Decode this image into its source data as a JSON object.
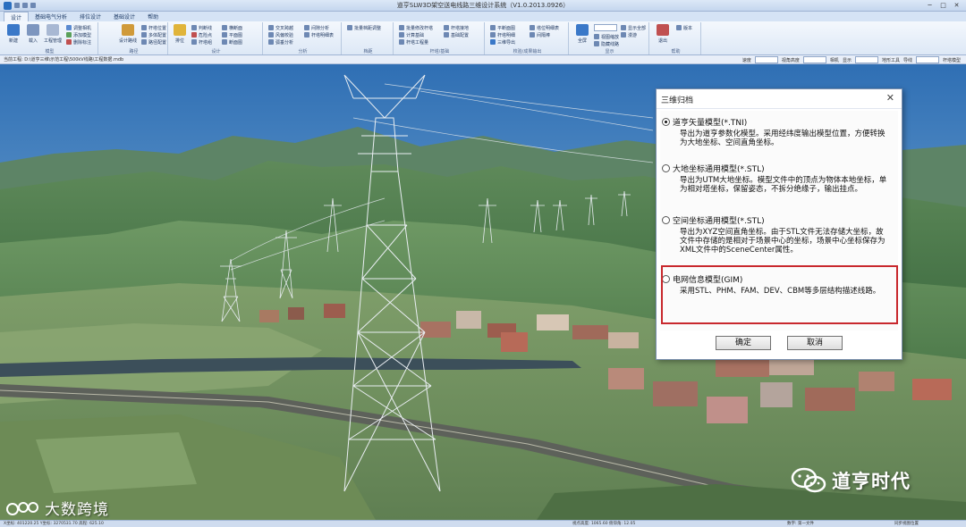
{
  "window": {
    "title": "道亨SLW3D架空送电线路三维设计系统（V1.0.2013.0926）"
  },
  "ribbon": {
    "tabs": [
      "设计",
      "基础电气分析",
      "排位设计",
      "基础设计",
      "帮助"
    ],
    "groups": [
      {
        "caption": "模型",
        "large": [
          {
            "label": "新建"
          },
          {
            "label": "载入"
          },
          {
            "label": "工程管理"
          }
        ],
        "small": [
          "调整相机",
          "添加模型",
          "删除标注",
          "模型标注",
          "绘点图"
        ]
      },
      {
        "caption": "路径",
        "large": [
          {
            "label": "设计路线"
          }
        ],
        "small": [
          "杆塔位置",
          "多体配置",
          "路径配置"
        ]
      },
      {
        "caption": "设计",
        "large": [
          {
            "label": "排位"
          }
        ],
        "small": [
          "判断线",
          "危险点",
          "杆塔组",
          "横断面",
          "平面图",
          "断面图"
        ]
      },
      {
        "caption": "分析",
        "small": [
          "交叉跨越",
          "风偏校验",
          "弧垂分析",
          "间隙分析",
          "杆塔明细表",
          "材料统计汇总"
        ]
      },
      {
        "caption": "档距",
        "small": [
          "批量档距调整"
        ]
      },
      {
        "caption": "杆塔/基础",
        "small": [
          "批量修改杆塔",
          "计算基础",
          "杆塔工程量",
          "杆塔接地",
          "基础配置",
          "塔基断面"
        ]
      },
      {
        "caption": "校验/成果输出",
        "small": [
          "平断面图",
          "杆塔明细",
          "三维导出",
          "塔位明细表",
          "间隔棒",
          "成果输出"
        ]
      },
      {
        "caption": "显示",
        "large": [
          {
            "label": "全屏"
          }
        ],
        "small": [
          "视图缩放",
          "隐藏线路",
          "显示全部",
          "漫游"
        ]
      },
      {
        "caption": "帮助",
        "large": [
          {
            "label": "退出"
          }
        ],
        "small": [
          "版本"
        ]
      }
    ]
  },
  "pathbar": {
    "path": "当前工程: D:\\道亨三维\\示范工程\\500kV线路\\工程数据.mdb",
    "controls": [
      "速度",
      "视角高度",
      "相机",
      "显示",
      "地形工具",
      "导线",
      "杆塔模型"
    ]
  },
  "dialog": {
    "title": "三维归档",
    "options": [
      {
        "name": "道亨矢量模型(*.TNI)",
        "desc": "导出为道亨参数化模型。采用经纬度输出模型位置，方便转换为大地坐标、空间直角坐标。",
        "selected": true
      },
      {
        "name": "大地坐标通用模型(*.STL)",
        "desc": "导出为UTM大地坐标。模型文件中的顶点为物体本地坐标，单为相对塔坐标，保留姿态，不拆分绝缘子，输出挂点。",
        "selected": false
      },
      {
        "name": "空间坐标通用模型(*.STL)",
        "desc": "导出为XYZ空间直角坐标。由于STL文件无法存储大坐标，故文件中存储的是相对于场景中心的坐标，场景中心坐标保存为XML文件中的SceneCenter属性。",
        "selected": false
      },
      {
        "name": "电网信息模型(GIM)",
        "desc": "采用STL、PHM、FAM、DEV、CBM等多层结构描述线路。",
        "selected": false
      }
    ],
    "ok_label": "确定",
    "cancel_label": "取消"
  },
  "status": {
    "left": "X坐标: 401220.25  Y坐标: 3270531.70  高程: 625.10",
    "mid": "视点高度: 1065.60  俯仰角: 12.05",
    "right": "数字: 第一文件",
    "far": "同步视图位置"
  },
  "watermarks": {
    "left": "大数跨境",
    "right": "道亨时代"
  },
  "colors": {
    "sky_top": "#2f6fb4",
    "sky_bottom": "#b8d3e8",
    "hills": "#4f7a4e",
    "dialog_highlight": "#c8282d"
  }
}
